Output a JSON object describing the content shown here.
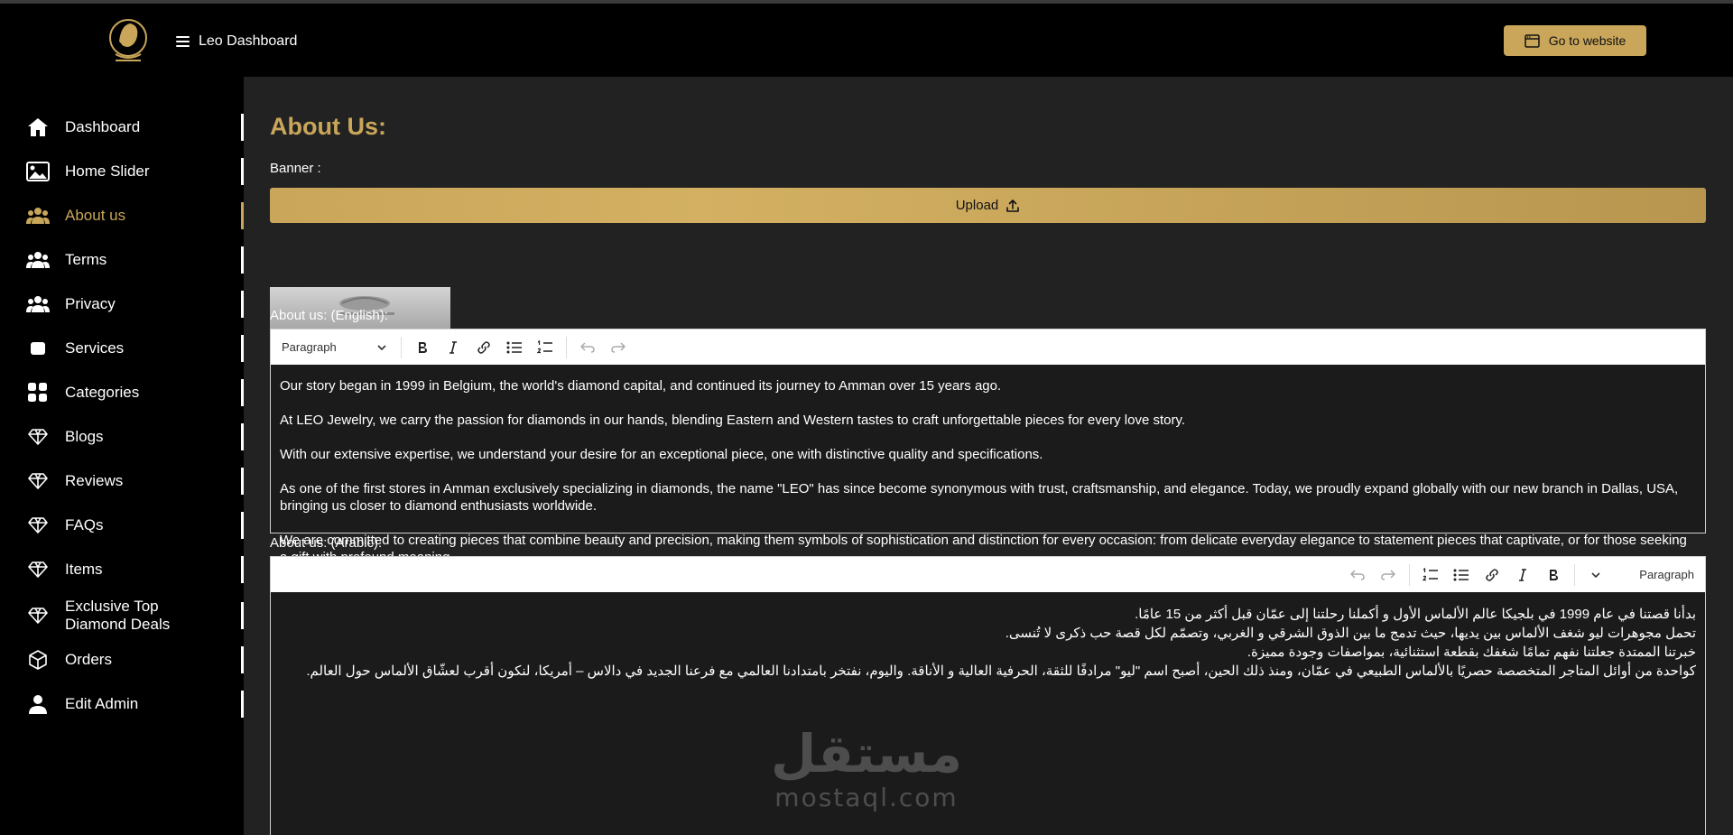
{
  "header": {
    "brand": "Leo Dashboard",
    "goto_label": "Go to website"
  },
  "sidebar": {
    "items": [
      {
        "label": "Dashboard",
        "icon": "home-icon"
      },
      {
        "label": "Home Slider",
        "icon": "image-icon"
      },
      {
        "label": "About us",
        "icon": "users-icon",
        "active": true
      },
      {
        "label": "Terms",
        "icon": "users-icon"
      },
      {
        "label": "Privacy",
        "icon": "users-icon"
      },
      {
        "label": "Services",
        "icon": "square-icon"
      },
      {
        "label": "Categories",
        "icon": "grid-icon"
      },
      {
        "label": "Blogs",
        "icon": "diamond-icon"
      },
      {
        "label": "Reviews",
        "icon": "diamond-icon"
      },
      {
        "label": "FAQs",
        "icon": "diamond-icon"
      },
      {
        "label": "Items",
        "icon": "diamond-icon"
      },
      {
        "label": "Exclusive Top Diamond Deals",
        "icon": "diamond-icon"
      },
      {
        "label": "Orders",
        "icon": "box-icon"
      },
      {
        "label": "Edit Admin",
        "icon": "user-icon"
      }
    ]
  },
  "main": {
    "title": "About Us:",
    "banner_label": "Banner :",
    "upload_label": "Upload",
    "english_label": "About us: (English):",
    "arabic_label": "About us: (Arabic):",
    "english_editor": {
      "block_type": "Paragraph",
      "paragraphs": [
        "Our story began in 1999 in Belgium, the world's diamond capital, and continued its journey to Amman over 15 years ago.",
        "At LEO Jewelry, we carry the passion for diamonds in our hands, blending Eastern and Western tastes to craft unforgettable pieces for every love story.",
        "With our extensive expertise, we understand your desire for an exceptional piece, one with distinctive quality and specifications.",
        "As one of the first stores in Amman exclusively specializing in diamonds, the name \"LEO\" has since become synonymous with trust, craftsmanship, and elegance. Today, we proudly expand globally with our new branch in Dallas, USA, bringing us closer to diamond enthusiasts worldwide.",
        "We are committed to creating pieces that combine beauty and precision, making them symbols of sophistication and distinction for every occasion: from delicate everyday elegance to statement pieces that captivate, or for those seeking a gift with profound meaning."
      ]
    },
    "arabic_editor": {
      "block_type": "Paragraph",
      "paragraphs": [
        "بدأنا قصتنا في عام 1999 في بلجيكا عالم الألماس الأول و أكملنا رحلتنا إلى عمّان قبل أكثر من 15 عامًا.",
        "تحمل مجوهرات ليو شغف الألماس بين يديها، حيث تدمج ما بين الذوق الشرقي و الغربي، وتصمّم لكل قصة حب ذكرى لا تُنسى.",
        "خبرتنا الممتدة جعلتنا نفهم تمامًا شغفك بقطعة استثنائية، بمواصفات وجودة مميزة.",
        "كواحدة من أوائل المتاجر المتخصصة حصريًا بالألماس الطبيعي في عمّان، ومنذ ذلك الحين، أصبح اسم \"ليو\" مرادفًا للثقة، الحرفية العالية و الأناقة. واليوم، نفتخر بامتدادنا العالمي مع فرعنا الجديد في دالاس – أمريكا، لنكون أقرب لعشّاق الألماس حول العالم."
      ]
    }
  },
  "watermark": {
    "arabic": "مستقل",
    "latin": "mostaql.com"
  },
  "colors": {
    "accent": "#c9a65a",
    "background": "#222222",
    "sidebar": "#000000"
  }
}
